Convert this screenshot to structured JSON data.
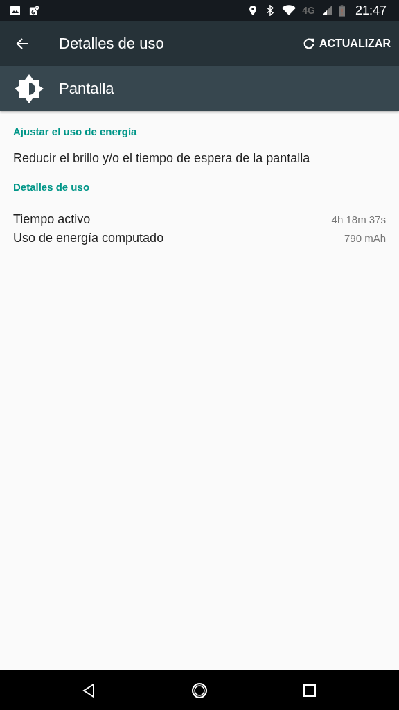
{
  "status_bar": {
    "network": "4G",
    "time": "21:47"
  },
  "toolbar": {
    "title": "Detalles de uso",
    "action": "ACTUALIZAR"
  },
  "header": {
    "title": "Pantalla"
  },
  "sections": [
    {
      "title": "Ajustar el uso de energía",
      "items": [
        {
          "kind": "action",
          "label": "Reducir el brillo y/o el tiempo de espera de la pantalla"
        }
      ]
    },
    {
      "title": "Detalles de uso",
      "items": [
        {
          "kind": "stat",
          "label": "Tiempo activo",
          "value": "4h 18m 37s"
        },
        {
          "kind": "stat",
          "label": "Uso de energía computado",
          "value": "790 mAh"
        }
      ]
    }
  ]
}
